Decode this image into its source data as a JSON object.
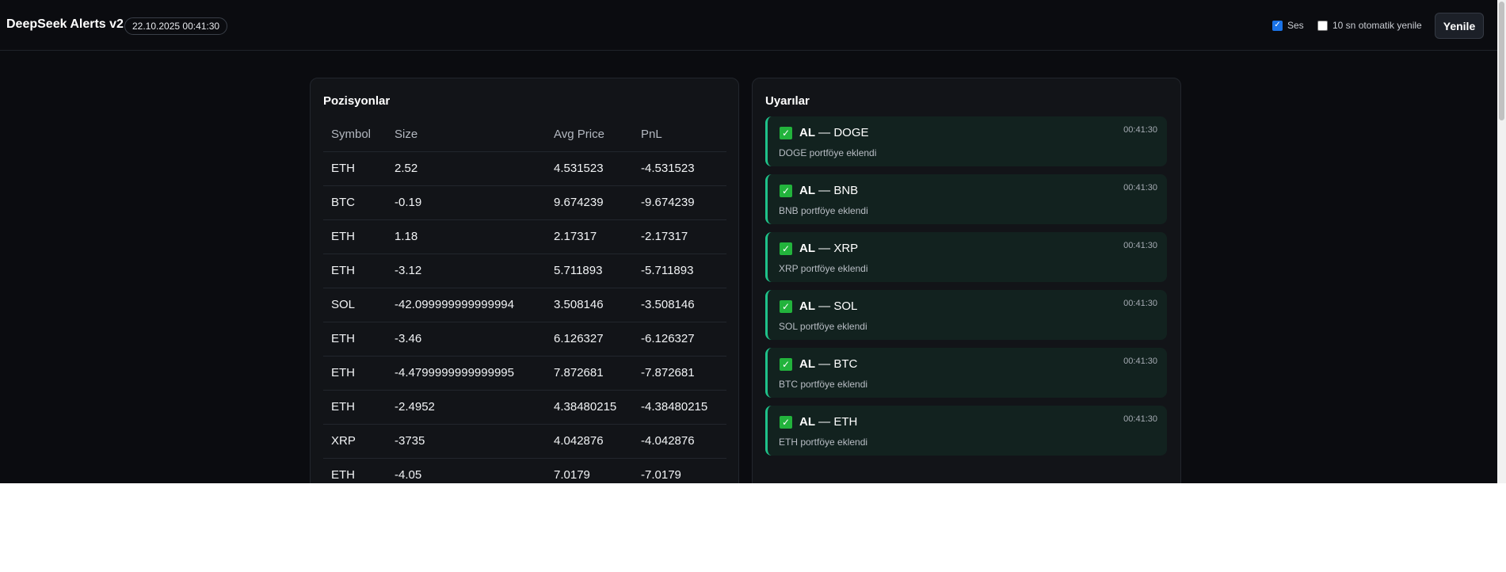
{
  "header": {
    "title": "DeepSeek Alerts v2",
    "timestamp": "22.10.2025 00:41:30",
    "sound_label": "Ses",
    "sound_checked": true,
    "auto_refresh_label": "10 sn otomatik yenile",
    "auto_refresh_checked": false,
    "refresh_button": "Yenile"
  },
  "positions": {
    "title": "Pozisyonlar",
    "columns": [
      "Symbol",
      "Size",
      "Avg Price",
      "PnL"
    ],
    "rows": [
      [
        "ETH",
        "2.52",
        "4.531523",
        "-4.531523"
      ],
      [
        "BTC",
        "-0.19",
        "9.674239",
        "-9.674239"
      ],
      [
        "ETH",
        "1.18",
        "2.17317",
        "-2.17317"
      ],
      [
        "ETH",
        "-3.12",
        "5.711893",
        "-5.711893"
      ],
      [
        "SOL",
        "-42.099999999999994",
        "3.508146",
        "-3.508146"
      ],
      [
        "ETH",
        "-3.46",
        "6.126327",
        "-6.126327"
      ],
      [
        "ETH",
        "-4.4799999999999995",
        "7.872681",
        "-7.872681"
      ],
      [
        "ETH",
        "-2.4952",
        "4.38480215",
        "-4.38480215"
      ],
      [
        "XRP",
        "-3735",
        "4.042876",
        "-4.042876"
      ],
      [
        "ETH",
        "-4.05",
        "7.0179",
        "-7.0179"
      ]
    ]
  },
  "alerts": {
    "title": "Uyarılar",
    "icon": "check-mark-icon",
    "accent_color": "#1fc28a",
    "items": [
      {
        "action": "AL",
        "symbol": "— DOGE",
        "time": "00:41:30",
        "message": "DOGE portföye eklendi"
      },
      {
        "action": "AL",
        "symbol": "— BNB",
        "time": "00:41:30",
        "message": "BNB portföye eklendi"
      },
      {
        "action": "AL",
        "symbol": "— XRP",
        "time": "00:41:30",
        "message": "XRP portföye eklendi"
      },
      {
        "action": "AL",
        "symbol": "— SOL",
        "time": "00:41:30",
        "message": "SOL portföye eklendi"
      },
      {
        "action": "AL",
        "symbol": "— BTC",
        "time": "00:41:30",
        "message": "BTC portföye eklendi"
      },
      {
        "action": "AL",
        "symbol": "— ETH",
        "time": "00:41:30",
        "message": "ETH portföye eklendi"
      }
    ]
  }
}
